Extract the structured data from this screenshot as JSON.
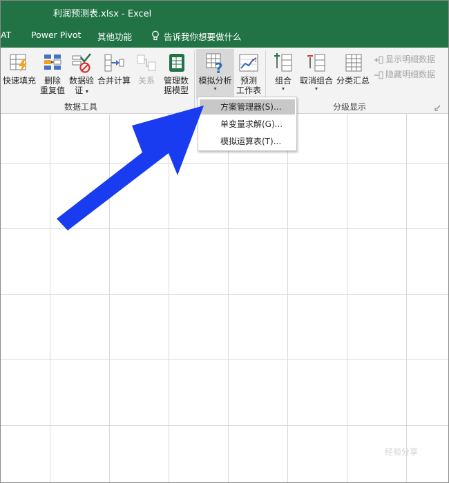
{
  "window": {
    "title": "利润预测表.xlsx  -  Excel"
  },
  "tabs": [
    {
      "label": "AT"
    },
    {
      "label": "Power Pivot"
    },
    {
      "label": "其他功能"
    }
  ],
  "tell_me": {
    "text": "告诉我你想要做什么"
  },
  "ribbon": {
    "data_tools": {
      "label": "数据工具",
      "buttons": [
        {
          "line1": "快速填充",
          "line2": ""
        },
        {
          "line1": "删除",
          "line2": "重复值"
        },
        {
          "line1": "数据验",
          "line2": "证"
        },
        {
          "line1": "合并计算",
          "line2": ""
        },
        {
          "line1": "关系",
          "line2": ""
        },
        {
          "line1": "管理数",
          "line2": "据模型"
        }
      ]
    },
    "forecast": {
      "buttons": [
        {
          "line1": "模拟分析",
          "line2": ""
        },
        {
          "line1": "预测",
          "line2": "工作表"
        }
      ]
    },
    "outline": {
      "label": "分级显示",
      "buttons": [
        {
          "line1": "组合",
          "line2": ""
        },
        {
          "line1": "取消组合",
          "line2": ""
        },
        {
          "line1": "分类汇总",
          "line2": ""
        }
      ],
      "show_detail": "显示明细数据",
      "hide_detail": "隐藏明细数据"
    }
  },
  "what_if_menu": {
    "items": [
      {
        "label": "方案管理器(S)..."
      },
      {
        "label": "单变量求解(G)..."
      },
      {
        "label": "模拟运算表(T)..."
      }
    ]
  },
  "watermark": "经验分享",
  "colors": {
    "excel_green": "#217346",
    "arrow_blue": "#1a3cf0",
    "ribbon_bg": "#f3f3f3"
  }
}
